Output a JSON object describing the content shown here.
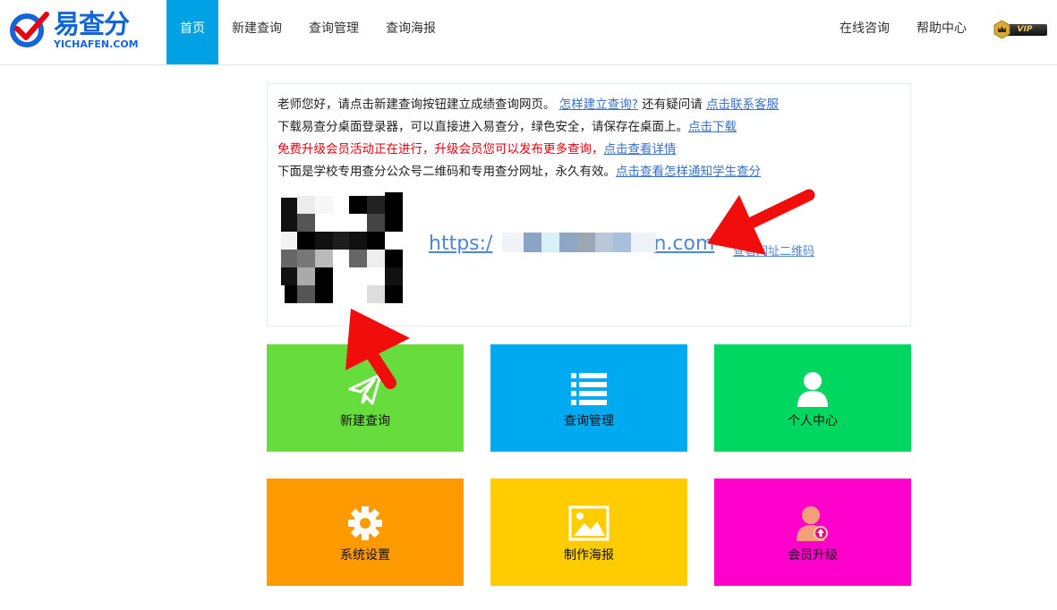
{
  "header": {
    "logo_cn": "易查分",
    "logo_en": "YICHAFEN.COM",
    "nav": [
      {
        "label": "首页",
        "active": true
      },
      {
        "label": "新建查询",
        "active": false
      },
      {
        "label": "查询管理",
        "active": false
      },
      {
        "label": "查询海报",
        "active": false
      }
    ],
    "right": [
      {
        "label": "在线咨询"
      },
      {
        "label": "帮助中心"
      }
    ],
    "vip_label": "VIP"
  },
  "info": {
    "line1_text": "老师您好，请点击新建查询按钮建立成绩查询网页。",
    "line1_link1": "怎样建立查询?",
    "line1_mid": "还有疑问请",
    "line1_link2": "点击联系客服",
    "line2_text": "下载易查分桌面登录器，可以直接进入易查分，绿色安全，请保存在桌面上。",
    "line2_link": "点击下载",
    "line3_text": "免费升级会员活动正在进行，升级会员您可以发布更多查询，",
    "line3_link": "点击查看详情",
    "line4_text": "下面是学校专用查分公众号二维码和专用查分网址，永久有效。",
    "line4_link": "点击查看怎样通知学生查分",
    "url_prefix": "https:/",
    "url_suffix": "n.com",
    "qr_link": "查看网址二维码"
  },
  "tiles": [
    {
      "label": "新建查询",
      "icon": "paper-plane-icon",
      "color": "#66dd3c"
    },
    {
      "label": "查询管理",
      "icon": "list-icon",
      "color": "#00aaf0"
    },
    {
      "label": "个人中心",
      "icon": "user-icon",
      "color": "#00d760"
    },
    {
      "label": "系统设置",
      "icon": "gear-icon",
      "color": "#ff9a00"
    },
    {
      "label": "制作海报",
      "icon": "image-icon",
      "color": "#ffcc00"
    },
    {
      "label": "会员升级",
      "icon": "member-upgrade-icon",
      "color": "#ff00cc"
    }
  ],
  "colors": {
    "nav_active": "#00a2e6",
    "brand_blue": "#1565d8",
    "link": "#3a72c9",
    "alert_red": "#e60012",
    "arrow_red": "#f20d0d"
  }
}
